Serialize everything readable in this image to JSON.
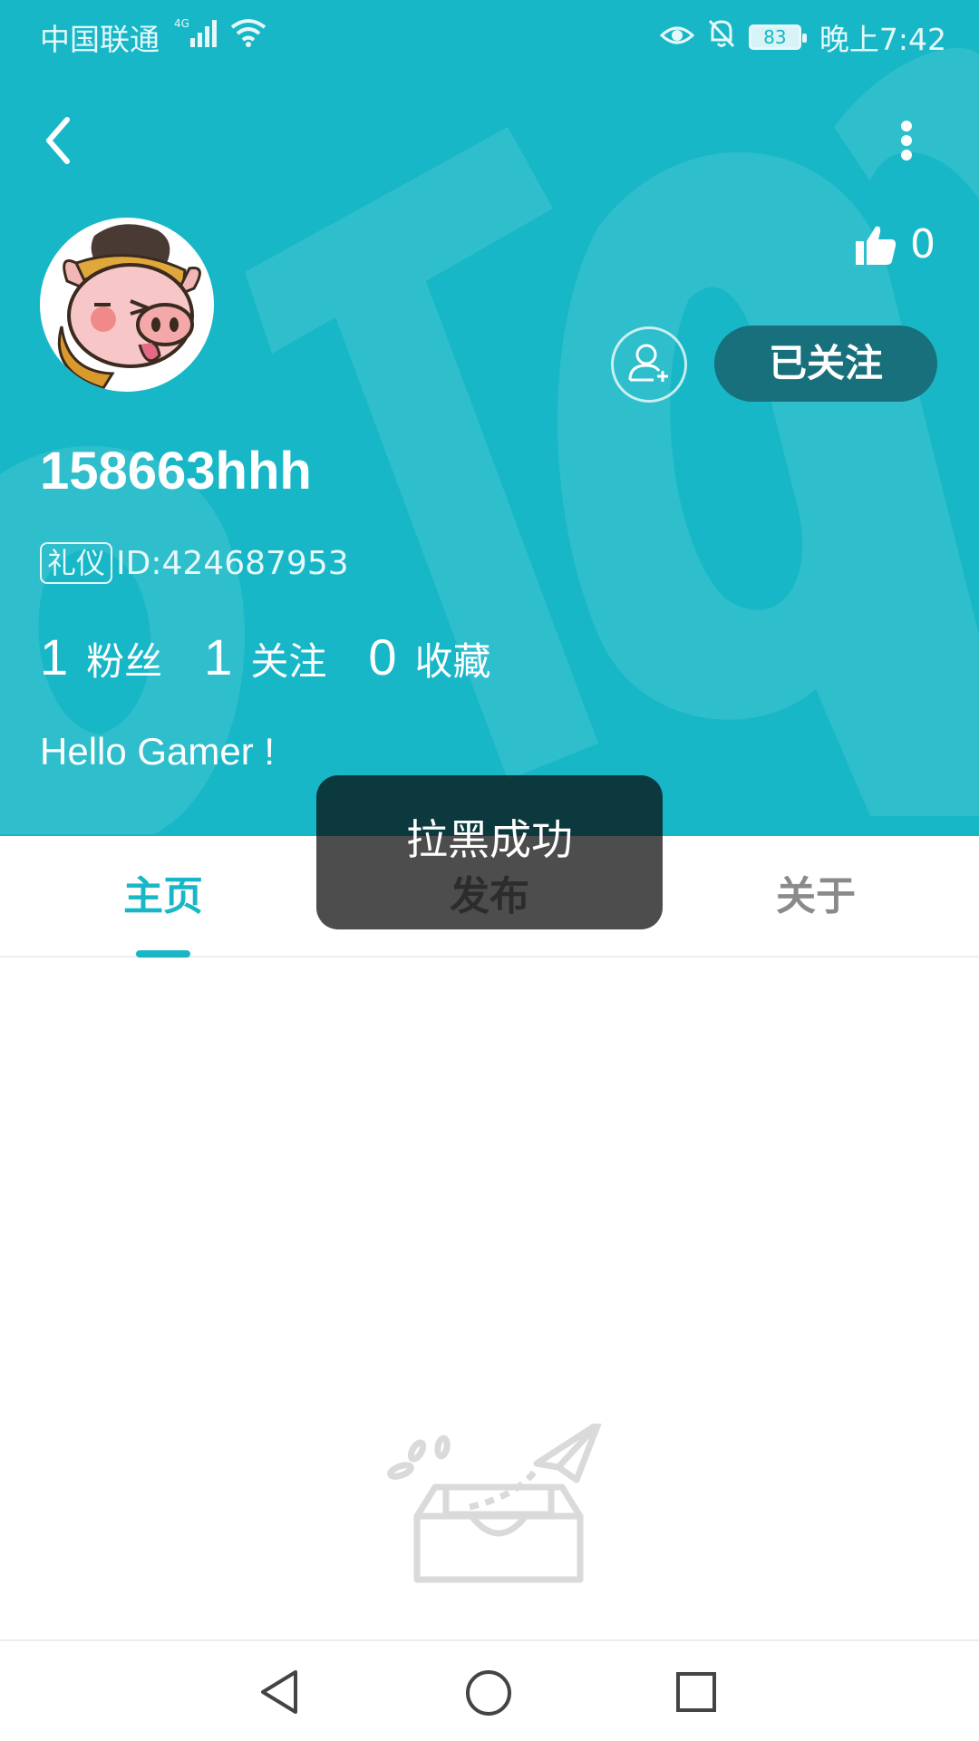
{
  "status_bar": {
    "carrier": "中国联通",
    "network": "4G",
    "battery": "83",
    "time": "晚上7:42"
  },
  "profile": {
    "likes": "0",
    "follow_label": "已关注",
    "username": "158663hhh",
    "badge": "礼仪",
    "id": "ID:424687953",
    "stats": [
      {
        "num": "1",
        "label": "粉丝"
      },
      {
        "num": "1",
        "label": "关注"
      },
      {
        "num": "0",
        "label": "收藏"
      }
    ],
    "bio": "Hello Gamer !"
  },
  "tabs": [
    {
      "label": "主页"
    },
    {
      "label": "发布"
    },
    {
      "label": "关于"
    }
  ],
  "toast": "拉黑成功",
  "colors": {
    "accent": "#17b7c7",
    "follow_button": "#17707b"
  }
}
